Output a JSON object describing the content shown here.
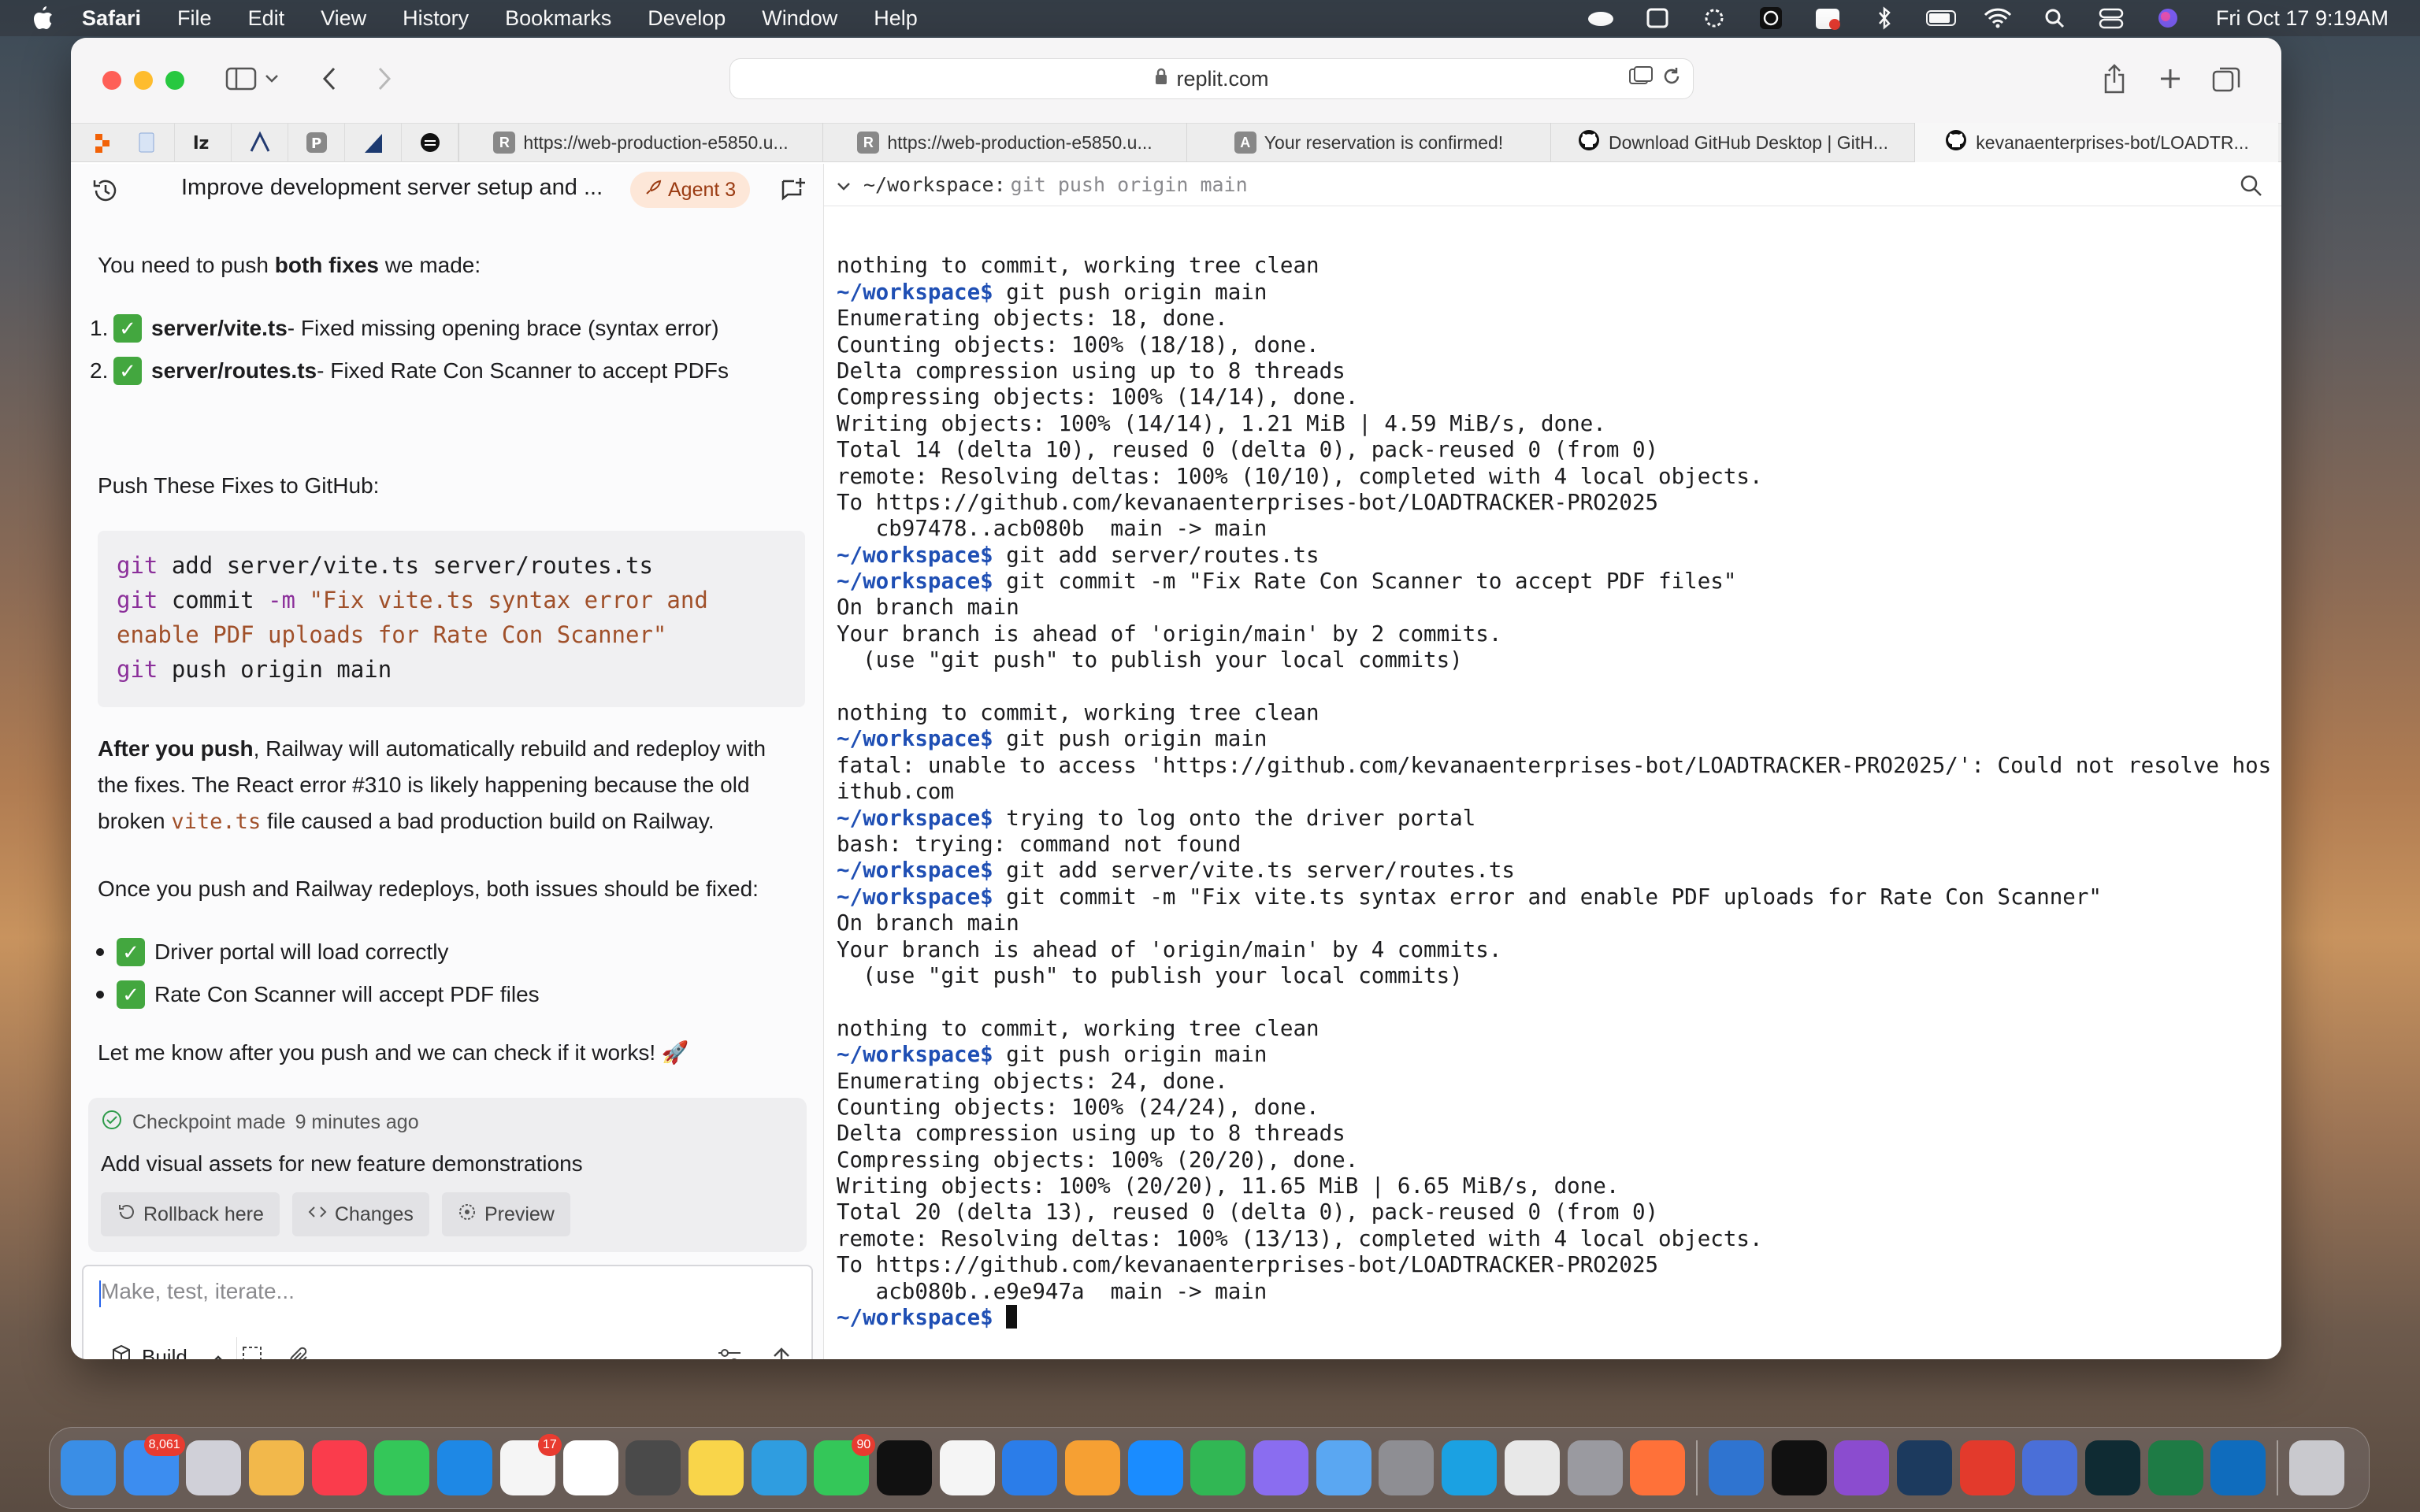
{
  "menubar": {
    "app": "Safari",
    "items": [
      "File",
      "Edit",
      "View",
      "History",
      "Bookmarks",
      "Develop",
      "Window",
      "Help"
    ],
    "clock": "Fri Oct 17  9:19AM"
  },
  "browser": {
    "url": "replit.com",
    "tabs": [
      {
        "favicon": "R",
        "label": "https://web-production-e5850.u..."
      },
      {
        "favicon": "R",
        "label": "https://web-production-e5850.u..."
      },
      {
        "favicon": "A",
        "label": "Your reservation is confirmed!"
      },
      {
        "favicon": "github-icon",
        "label": "Download GitHub Desktop | GitH..."
      },
      {
        "favicon": "github-icon",
        "label": "kevanaenterprises-bot/LOADTR..."
      }
    ]
  },
  "chat": {
    "title": "Improve development server setup and ...",
    "agent_badge": "Agent 3",
    "intro_pre": "You need to push ",
    "intro_bold": "both fixes",
    "intro_post": " we made:",
    "fixes": [
      {
        "num": "1.",
        "file": "server/vite.ts",
        "desc": " - Fixed missing opening brace (syntax error)"
      },
      {
        "num": "2.",
        "file": "server/routes.ts",
        "desc": " - Fixed Rate Con Scanner to accept PDFs"
      }
    ],
    "push_heading": "Push These Fixes to GitHub:",
    "code": {
      "l1_kw": "git",
      "l1_rest": " add server/vite.ts server/routes.ts",
      "l2_kw": "git",
      "l2_mid": " commit ",
      "l2_flag": "-m",
      "l2_str": " \"Fix vite.ts syntax error and",
      "l3_str": "enable PDF uploads for Rate Con Scanner\"",
      "l4_kw": "git",
      "l4_rest": " push origin main"
    },
    "after_bold": "After you push",
    "after_l1": ", Railway will automatically rebuild and redeploy with",
    "after_l2": "the fixes. The React error #310 is likely happening because the old",
    "after_l3_pre": "broken ",
    "after_l3_code": "vite.ts",
    "after_l3_post": " file caused a bad production build on Railway.",
    "once": "Once you push and Railway redeploys, both issues should be fixed:",
    "bullets": [
      "Driver portal will load correctly",
      "Rate Con Scanner will accept PDF files"
    ],
    "closing": "Let me know after you push and we can check if it works! 🚀",
    "checkpoint": {
      "label": "Checkpoint made",
      "time": "9 minutes ago",
      "title": "Add visual assets for new feature demonstrations",
      "buttons": [
        "Rollback here",
        "Changes",
        "Preview"
      ]
    },
    "composer": {
      "placeholder": "Make, test, iterate...",
      "mode": "Build"
    }
  },
  "terminal": {
    "header_path": "~/workspace:",
    "header_cmd": "git push origin main",
    "lines": [
      {
        "t": "",
        "p": ""
      },
      {
        "t": "nothing to commit, working tree clean",
        "p": ""
      },
      {
        "t": " git push origin main",
        "p": "~/workspace$"
      },
      {
        "t": "Enumerating objects: 18, done.",
        "p": ""
      },
      {
        "t": "Counting objects: 100% (18/18), done.",
        "p": ""
      },
      {
        "t": "Delta compression using up to 8 threads",
        "p": ""
      },
      {
        "t": "Compressing objects: 100% (14/14), done.",
        "p": ""
      },
      {
        "t": "Writing objects: 100% (14/14), 1.21 MiB | 4.59 MiB/s, done.",
        "p": ""
      },
      {
        "t": "Total 14 (delta 10), reused 0 (delta 0), pack-reused 0 (from 0)",
        "p": ""
      },
      {
        "t": "remote: Resolving deltas: 100% (10/10), completed with 4 local objects.",
        "p": ""
      },
      {
        "t": "To https://github.com/kevanaenterprises-bot/LOADTRACKER-PRO2025",
        "p": ""
      },
      {
        "t": "   cb97478..acb080b  main -> main",
        "p": ""
      },
      {
        "t": " git add server/routes.ts",
        "p": "~/workspace$"
      },
      {
        "t": " git commit -m \"Fix Rate Con Scanner to accept PDF files\"",
        "p": "~/workspace$"
      },
      {
        "t": "On branch main",
        "p": ""
      },
      {
        "t": "Your branch is ahead of 'origin/main' by 2 commits.",
        "p": ""
      },
      {
        "t": "  (use \"git push\" to publish your local commits)",
        "p": ""
      },
      {
        "t": "",
        "p": ""
      },
      {
        "t": "nothing to commit, working tree clean",
        "p": ""
      },
      {
        "t": " git push origin main",
        "p": "~/workspace$"
      },
      {
        "t": "fatal: unable to access 'https://github.com/kevanaenterprises-bot/LOADTRACKER-PRO2025/': Could not resolve hos",
        "p": ""
      },
      {
        "t": "ithub.com",
        "p": ""
      },
      {
        "t": " trying to log onto the driver portal",
        "p": "~/workspace$"
      },
      {
        "t": "bash: trying: command not found",
        "p": ""
      },
      {
        "t": " git add server/vite.ts server/routes.ts",
        "p": "~/workspace$"
      },
      {
        "t": " git commit -m \"Fix vite.ts syntax error and enable PDF uploads for Rate Con Scanner\"",
        "p": "~/workspace$"
      },
      {
        "t": "On branch main",
        "p": ""
      },
      {
        "t": "Your branch is ahead of 'origin/main' by 4 commits.",
        "p": ""
      },
      {
        "t": "  (use \"git push\" to publish your local commits)",
        "p": ""
      },
      {
        "t": "",
        "p": ""
      },
      {
        "t": "nothing to commit, working tree clean",
        "p": ""
      },
      {
        "t": " git push origin main",
        "p": "~/workspace$"
      },
      {
        "t": "Enumerating objects: 24, done.",
        "p": ""
      },
      {
        "t": "Counting objects: 100% (24/24), done.",
        "p": ""
      },
      {
        "t": "Delta compression using up to 8 threads",
        "p": ""
      },
      {
        "t": "Compressing objects: 100% (20/20), done.",
        "p": ""
      },
      {
        "t": "Writing objects: 100% (20/20), 11.65 MiB | 6.65 MiB/s, done.",
        "p": ""
      },
      {
        "t": "Total 20 (delta 13), reused 0 (delta 0), pack-reused 0 (from 0)",
        "p": ""
      },
      {
        "t": "remote: Resolving deltas: 100% (13/13), completed with 4 local objects.",
        "p": ""
      },
      {
        "t": "To https://github.com/kevanaenterprises-bot/LOADTRACKER-PRO2025",
        "p": ""
      },
      {
        "t": "   acb080b..e9e947a  main -> main",
        "p": ""
      }
    ],
    "final_prompt": "~/workspace$"
  },
  "dock": {
    "items": [
      {
        "name": "finder-icon",
        "color": "#3a8ee6",
        "badge": ""
      },
      {
        "name": "mail-icon",
        "color": "#3c8df0",
        "badge": "8,061"
      },
      {
        "name": "launchpad-icon",
        "color": "#d0d0d8",
        "badge": ""
      },
      {
        "name": "photos-icon",
        "color": "#f2b84b",
        "badge": ""
      },
      {
        "name": "music-icon",
        "color": "#fa3c4c",
        "badge": ""
      },
      {
        "name": "facetime-icon",
        "color": "#34c759",
        "badge": ""
      },
      {
        "name": "safari-icon",
        "color": "#1e88e5",
        "badge": ""
      },
      {
        "name": "reminders-icon",
        "color": "#f5f5f5",
        "badge": "17"
      },
      {
        "name": "calendar-icon",
        "color": "#ffffff",
        "badge": ""
      },
      {
        "name": "calculator-icon",
        "color": "#4a4a4a",
        "badge": ""
      },
      {
        "name": "notes-icon",
        "color": "#f9d54a",
        "badge": ""
      },
      {
        "name": "freeform-icon",
        "color": "#2f9de0",
        "badge": ""
      },
      {
        "name": "messages-icon",
        "color": "#34c759",
        "badge": "90"
      },
      {
        "name": "appletv-icon",
        "color": "#111111",
        "badge": ""
      },
      {
        "name": "news-icon",
        "color": "#f5f5f5",
        "badge": ""
      },
      {
        "name": "keynote-icon",
        "color": "#2b7de9",
        "badge": ""
      },
      {
        "name": "pages-icon",
        "color": "#f6a033",
        "badge": ""
      },
      {
        "name": "appstore-icon",
        "color": "#1a8cff",
        "badge": ""
      },
      {
        "name": "numbers-icon",
        "color": "#31b754",
        "badge": ""
      },
      {
        "name": "copilot-icon",
        "color": "#8a6df0",
        "badge": ""
      },
      {
        "name": "xcode-icon",
        "color": "#5aa7f2",
        "badge": ""
      },
      {
        "name": "settings-icon",
        "color": "#8e8e93",
        "badge": ""
      },
      {
        "name": "edge-icon",
        "color": "#1ba1e2",
        "badge": ""
      },
      {
        "name": "chrome-icon",
        "color": "#e8e8e8",
        "badge": ""
      },
      {
        "name": "help-icon",
        "color": "#9a9aa0",
        "badge": ""
      },
      {
        "name": "firefox-icon",
        "color": "#ff7139",
        "badge": ""
      },
      {
        "name": "teamviewer-icon",
        "color": "#2f74d0",
        "badge": ""
      },
      {
        "name": "chatgpt-icon",
        "color": "#111111",
        "badge": ""
      },
      {
        "name": "github-desktop-icon",
        "color": "#8b4ccf",
        "badge": ""
      },
      {
        "name": "affinity-icon",
        "color": "#1c3a5e",
        "badge": ""
      },
      {
        "name": "creative-cloud-icon",
        "color": "#e33a2c",
        "badge": ""
      },
      {
        "name": "printer-icon",
        "color": "#4a6fd8",
        "badge": ""
      },
      {
        "name": "perplexity-icon",
        "color": "#0f2b33",
        "badge": ""
      },
      {
        "name": "excel-icon",
        "color": "#1e7b45",
        "badge": ""
      },
      {
        "name": "outlook-icon",
        "color": "#0f6cbd",
        "badge": ""
      },
      {
        "name": "trash-icon",
        "color": "#c9c9ce",
        "badge": ""
      }
    ]
  }
}
